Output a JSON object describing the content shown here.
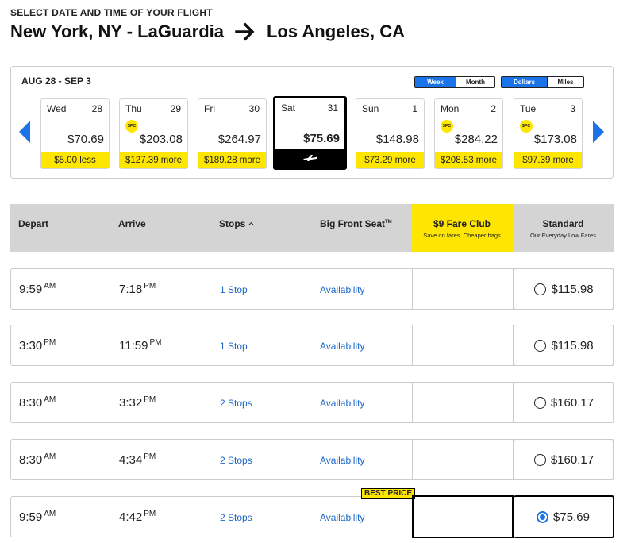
{
  "header": {
    "kicker": "SELECT DATE AND TIME OF YOUR FLIGHT",
    "origin": "New York, NY - LaGuardia",
    "destination": "Los Angeles, CA"
  },
  "calendar": {
    "range": "AUG 28 - SEP 3",
    "view_toggle": [
      "Week",
      "Month"
    ],
    "unit_toggle": [
      "Dollars",
      "Miles"
    ],
    "fare_club_badge": "$FC",
    "days": [
      {
        "name": "Wed",
        "num": "28",
        "price": "$70.69",
        "diff": "$5.00 less",
        "fc": false
      },
      {
        "name": "Thu",
        "num": "29",
        "price": "$203.08",
        "diff": "$127.39 more",
        "fc": true
      },
      {
        "name": "Fri",
        "num": "30",
        "price": "$264.97",
        "diff": "$189.28 more",
        "fc": false
      },
      {
        "name": "Sat",
        "num": "31",
        "price": "$75.69",
        "diff": "",
        "fc": false
      },
      {
        "name": "Sun",
        "num": "1",
        "price": "$148.98",
        "diff": "$73.29 more",
        "fc": false
      },
      {
        "name": "Mon",
        "num": "2",
        "price": "$284.22",
        "diff": "$208.53 more",
        "fc": true
      },
      {
        "name": "Tue",
        "num": "3",
        "price": "$173.08",
        "diff": "$97.39 more",
        "fc": true
      }
    ]
  },
  "table": {
    "headers": {
      "depart": "Depart",
      "arrive": "Arrive",
      "stops": "Stops",
      "bfs": "Big Front Seat",
      "bfs_tm": "TM",
      "fare_club": "$9 Fare Club",
      "fare_club_sub": "Save on fares. Cheaper bags",
      "standard": "Standard",
      "standard_sub": "Our Everyday Low Fares"
    },
    "availability_label": "Availability",
    "best_price_label": "BEST PRICE",
    "rows": [
      {
        "dep": "9:59",
        "dep_ap": "AM",
        "arr": "7:18",
        "arr_ap": "PM",
        "stops": "1 Stop",
        "price": "$115.98"
      },
      {
        "dep": "3:30",
        "dep_ap": "PM",
        "arr": "11:59",
        "arr_ap": "PM",
        "stops": "1 Stop",
        "price": "$115.98"
      },
      {
        "dep": "8:30",
        "dep_ap": "AM",
        "arr": "3:32",
        "arr_ap": "PM",
        "stops": "2 Stops",
        "price": "$160.17"
      },
      {
        "dep": "8:30",
        "dep_ap": "AM",
        "arr": "4:34",
        "arr_ap": "PM",
        "stops": "2 Stops",
        "price": "$160.17"
      },
      {
        "dep": "9:59",
        "dep_ap": "AM",
        "arr": "4:42",
        "arr_ap": "PM",
        "stops": "2 Stops",
        "price": "$75.69"
      }
    ]
  },
  "colors": {
    "accent": "#1a73e8",
    "highlight": "#ffe600",
    "link": "#1a66c9"
  }
}
